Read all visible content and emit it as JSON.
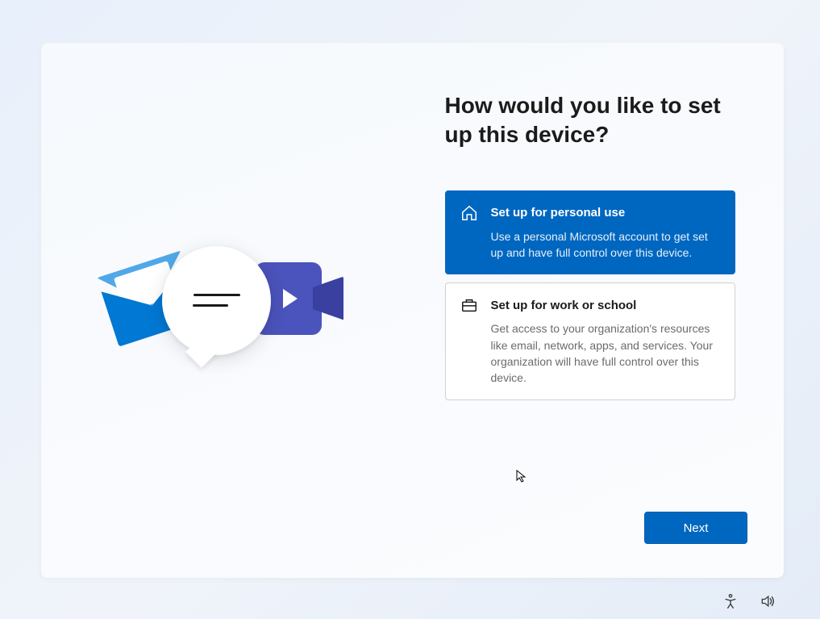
{
  "heading": "How would you like to set up this device?",
  "options": {
    "personal": {
      "title": "Set up for personal use",
      "description": "Use a personal Microsoft account to get set up and have full control over this device.",
      "selected": true
    },
    "work": {
      "title": "Set up for work or school",
      "description": "Get access to your organization's resources like email, network, apps, and services. Your organization will have full control over this device.",
      "selected": false
    }
  },
  "buttons": {
    "next": "Next"
  }
}
